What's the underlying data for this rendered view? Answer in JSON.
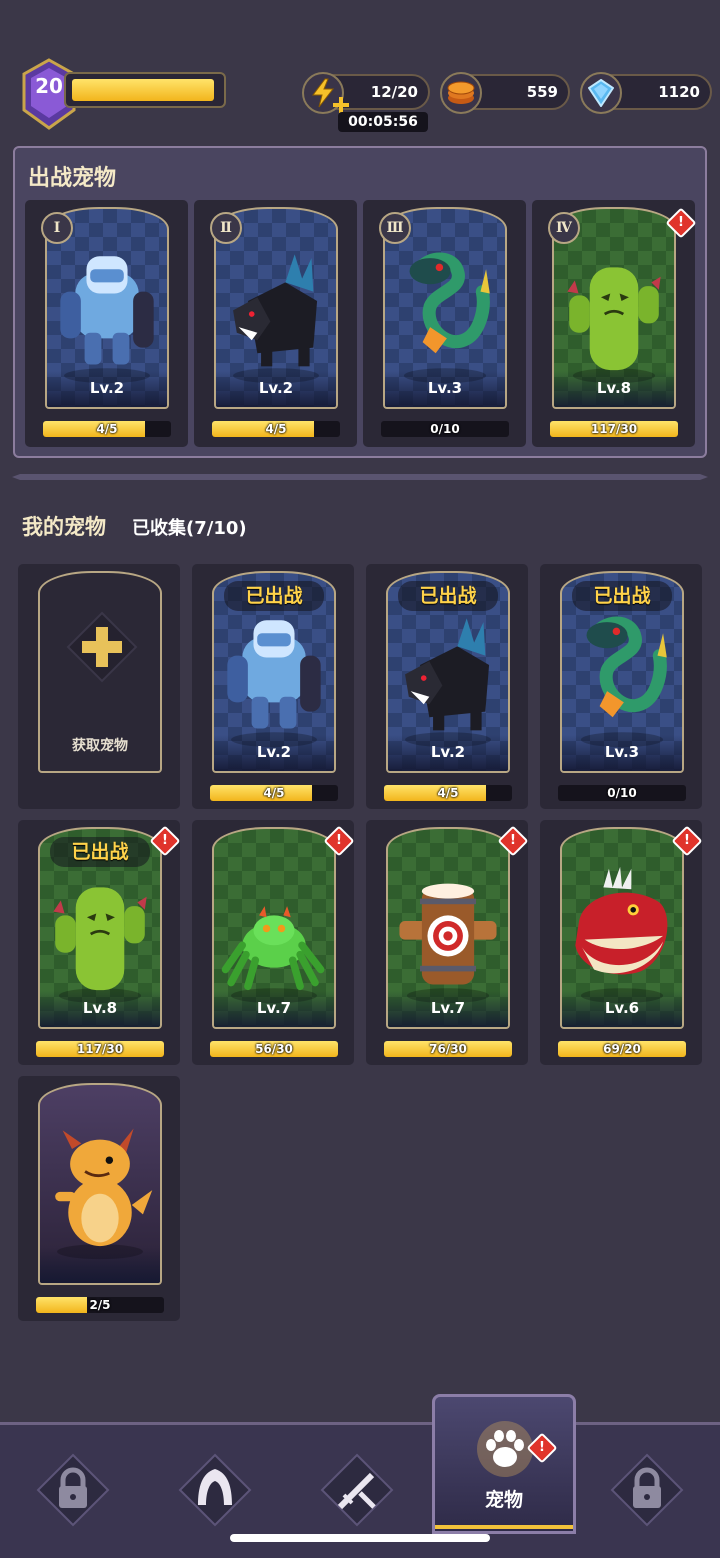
{
  "player": {
    "level": "20",
    "xp_fraction": 0.97
  },
  "resources": {
    "energy": "12/20",
    "energy_timer": "00:05:56",
    "coins": "559",
    "gems": "1120"
  },
  "battle_section": {
    "title": "出战宠物",
    "slots": [
      {
        "roman": "Ⅰ",
        "level": "Lv.2",
        "progress": "4/5",
        "fill": 0.8,
        "bg": "blue",
        "pet": "ice-golem"
      },
      {
        "roman": "Ⅱ",
        "level": "Lv.2",
        "progress": "4/5",
        "fill": 0.8,
        "bg": "blue",
        "pet": "shadow-wolf"
      },
      {
        "roman": "Ⅲ",
        "level": "Lv.3",
        "progress": "0/10",
        "fill": 0,
        "bg": "blue",
        "pet": "serpent"
      },
      {
        "roman": "Ⅳ",
        "level": "Lv.8",
        "progress": "117/30",
        "fill": 1,
        "bg": "green",
        "pet": "cactus",
        "alert": true
      }
    ]
  },
  "my_pets": {
    "title": "我的宠物",
    "collected": "已收集(7/10)",
    "add_label": "获取宠物",
    "deployed_label": "已出战",
    "alert_glyph": "!",
    "pets": [
      {
        "level": "Lv.2",
        "progress": "4/5",
        "fill": 0.8,
        "bg": "blue",
        "pet": "ice-golem",
        "deployed": true
      },
      {
        "level": "Lv.2",
        "progress": "4/5",
        "fill": 0.8,
        "bg": "blue",
        "pet": "shadow-wolf",
        "deployed": true
      },
      {
        "level": "Lv.3",
        "progress": "0/10",
        "fill": 0,
        "bg": "blue",
        "pet": "serpent",
        "deployed": true
      },
      {
        "level": "Lv.8",
        "progress": "117/30",
        "fill": 1,
        "bg": "green",
        "pet": "cactus",
        "deployed": true,
        "alert": true
      },
      {
        "level": "Lv.7",
        "progress": "56/30",
        "fill": 1,
        "bg": "green",
        "pet": "spider",
        "alert": true
      },
      {
        "level": "Lv.7",
        "progress": "76/30",
        "fill": 1,
        "bg": "green",
        "pet": "target-barrel",
        "alert": true
      },
      {
        "level": "Lv.6",
        "progress": "69/20",
        "fill": 1,
        "bg": "green",
        "pet": "piranha",
        "alert": true
      },
      {
        "level": "",
        "progress": "2/5",
        "fill": 0.4,
        "bg": "purple",
        "pet": "dragon"
      }
    ]
  },
  "nav": {
    "tabs": [
      {
        "icon": "lock-icon",
        "locked": true
      },
      {
        "icon": "hood-icon"
      },
      {
        "icon": "swords-icon"
      },
      {
        "icon": "paw-icon",
        "label": "宠物",
        "active": true,
        "alert": true
      },
      {
        "icon": "lock-icon",
        "locked": true
      }
    ]
  },
  "colors": {
    "background": "#3b3748",
    "gold": "#f2b51c",
    "alert_red": "#e0342b",
    "title_cream": "#f4e9c7"
  }
}
